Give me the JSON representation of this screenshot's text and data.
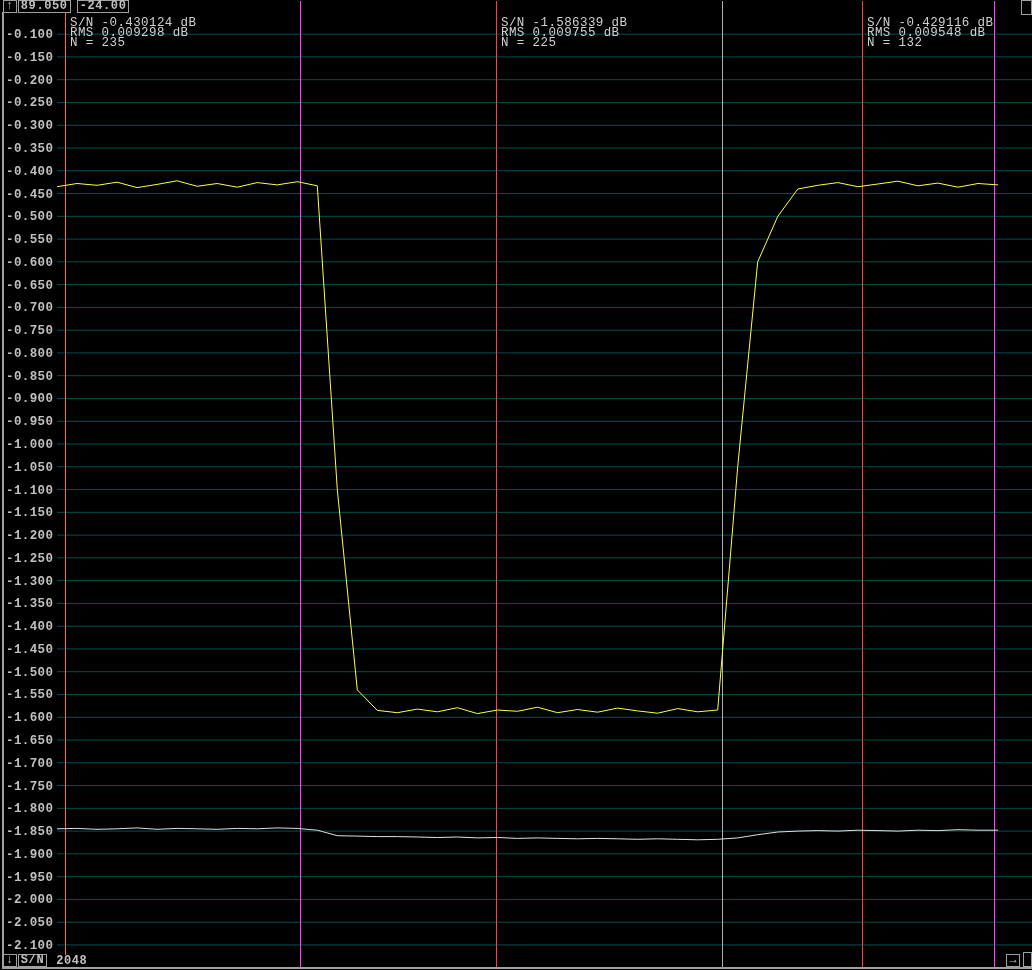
{
  "top_bar": {
    "scroll_up": "↑",
    "value_1": "89.050",
    "value_2": "-24.00"
  },
  "plot": {
    "chart_data": {
      "type": "line",
      "grid": true,
      "ylim": [
        -2.155,
        -0.025
      ],
      "yticks": [
        {
          "value": -0.1,
          "label": "-0.100"
        },
        {
          "value": -0.15,
          "label": "-0.150"
        },
        {
          "value": -0.2,
          "label": "-0.200"
        },
        {
          "value": -0.25,
          "label": "-0.250"
        },
        {
          "value": -0.3,
          "label": "-0.300"
        },
        {
          "value": -0.35,
          "label": "-0.350"
        },
        {
          "value": -0.4,
          "label": "-0.400"
        },
        {
          "value": -0.45,
          "label": "-0.450"
        },
        {
          "value": -0.5,
          "label": "-0.500"
        },
        {
          "value": -0.55,
          "label": "-0.550"
        },
        {
          "value": -0.6,
          "label": "-0.600"
        },
        {
          "value": -0.65,
          "label": "-0.650"
        },
        {
          "value": -0.7,
          "label": "-0.700"
        },
        {
          "value": -0.75,
          "label": "-0.750"
        },
        {
          "value": -0.8,
          "label": "-0.800"
        },
        {
          "value": -0.85,
          "label": "-0.850"
        },
        {
          "value": -0.9,
          "label": "-0.900"
        },
        {
          "value": -0.95,
          "label": "-0.950"
        },
        {
          "value": -1.0,
          "label": "-1.000"
        },
        {
          "value": -1.05,
          "label": "-1.050"
        },
        {
          "value": -1.1,
          "label": "-1.100"
        },
        {
          "value": -1.15,
          "label": "-1.150"
        },
        {
          "value": -1.2,
          "label": "-1.200"
        },
        {
          "value": -1.25,
          "label": "-1.250"
        },
        {
          "value": -1.3,
          "label": "-1.300"
        },
        {
          "value": -1.35,
          "label": "-1.350"
        },
        {
          "value": -1.4,
          "label": "-1.400"
        },
        {
          "value": -1.45,
          "label": "-1.450"
        },
        {
          "value": -1.5,
          "label": "-1.500"
        },
        {
          "value": -1.55,
          "label": "-1.550"
        },
        {
          "value": -1.6,
          "label": "-1.600"
        },
        {
          "value": -1.65,
          "label": "-1.650"
        },
        {
          "value": -1.7,
          "label": "-1.700"
        },
        {
          "value": -1.75,
          "label": "-1.750"
        },
        {
          "value": -1.8,
          "label": "-1.800"
        },
        {
          "value": -1.85,
          "label": "-1.850"
        },
        {
          "value": -1.9,
          "label": "-1.900"
        },
        {
          "value": -1.95,
          "label": "-1.950"
        },
        {
          "value": -2.0,
          "label": "-2.000"
        },
        {
          "value": -2.05,
          "label": "-2.050"
        },
        {
          "value": -2.1,
          "label": "-2.100"
        }
      ],
      "categories": [
        null,
        null,
        null,
        null,
        null,
        null,
        null,
        null,
        null,
        null,
        null,
        null,
        null,
        null,
        null,
        null,
        null,
        null,
        null,
        null,
        null,
        null,
        null,
        null,
        null,
        null,
        null,
        null,
        null,
        null,
        null,
        null,
        null,
        null,
        null,
        null,
        null,
        null,
        null,
        null,
        null,
        null,
        null,
        null,
        null,
        null,
        null,
        null
      ],
      "series": [
        {
          "color": "#ffff40",
          "values": [
            -0.435,
            -0.428,
            -0.432,
            -0.425,
            -0.437,
            -0.43,
            -0.422,
            -0.434,
            -0.428,
            -0.436,
            -0.426,
            -0.431,
            -0.424,
            -0.433,
            -1.1,
            -1.54,
            -1.585,
            -1.59,
            -1.582,
            -1.588,
            -1.579,
            -1.592,
            -1.584,
            -1.587,
            -1.578,
            -1.59,
            -1.583,
            -1.589,
            -1.58,
            -1.586,
            -1.591,
            -1.581,
            -1.588,
            -1.584,
            -1.05,
            -0.6,
            -0.5,
            -0.44,
            -0.432,
            -0.426,
            -0.435,
            -0.429,
            -0.423,
            -0.433,
            -0.427,
            -0.436,
            -0.428,
            -0.431
          ]
        },
        {
          "color": "#e0e0e0",
          "values": [
            -1.845,
            -1.844,
            -1.846,
            -1.845,
            -1.843,
            -1.846,
            -1.844,
            -1.845,
            -1.846,
            -1.844,
            -1.845,
            -1.843,
            -1.844,
            -1.848,
            -1.86,
            -1.861,
            -1.862,
            -1.862,
            -1.863,
            -1.864,
            -1.863,
            -1.865,
            -1.864,
            -1.866,
            -1.865,
            -1.866,
            -1.867,
            -1.866,
            -1.867,
            -1.868,
            -1.867,
            -1.868,
            -1.869,
            -1.868,
            -1.865,
            -1.858,
            -1.852,
            -1.85,
            -1.849,
            -1.85,
            -1.848,
            -1.849,
            -1.85,
            -1.848,
            -1.849,
            -1.847,
            -1.848,
            -1.848
          ]
        }
      ]
    },
    "markers": [
      {
        "color": "#ff6060",
        "stats": {
          "sn": "S/N -0.430124 dB",
          "rms": "RMS 0.009298 dB",
          "n": "N = 235"
        }
      },
      {
        "color": "#ff40ff"
      },
      {
        "color": "#ff4040",
        "stats": {
          "sn": "S/N -1.586339 dB",
          "rms": "RMS 0.009755 dB",
          "n": "N = 225"
        }
      },
      {
        "color": "#b0b0b0"
      },
      {
        "color": "#ff4040",
        "stats": {
          "sn": "S/N -0.429116 dB",
          "rms": "RMS 0.009548 dB",
          "n": "N = 132"
        }
      },
      {
        "color": "#ff40ff"
      }
    ]
  },
  "bottom_bar": {
    "scroll_down": "↓",
    "mode": "S/N",
    "count": "2048",
    "scroll_right": "→"
  }
}
